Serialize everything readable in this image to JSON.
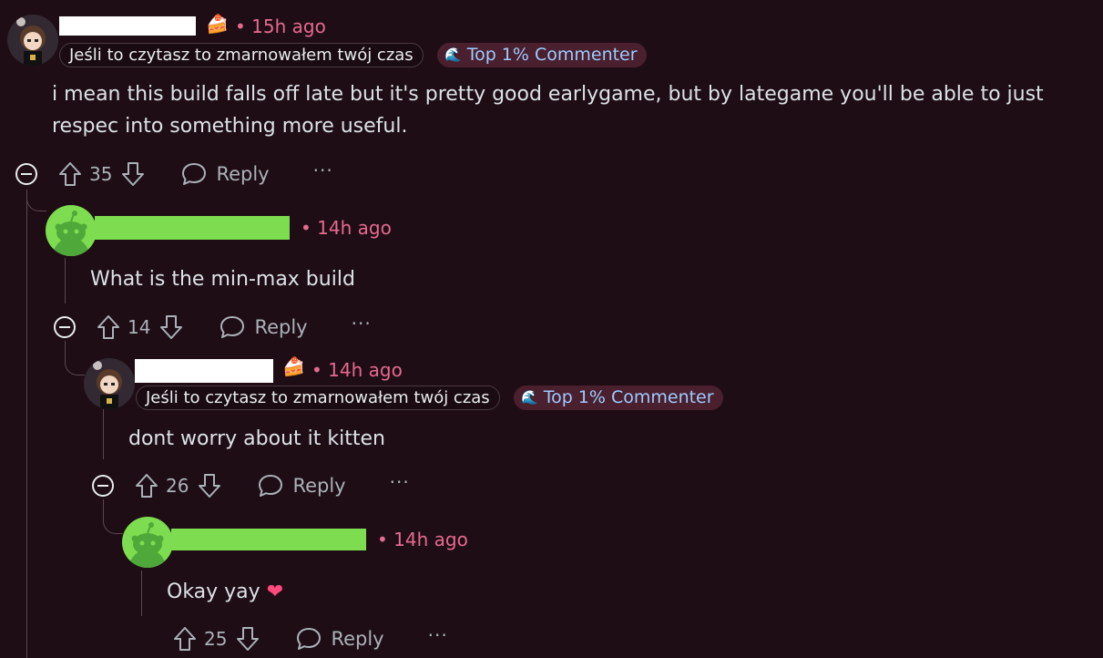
{
  "comments": [
    {
      "timestamp": "15h ago",
      "flair": "Jeśli to czytasz to zmarnowałem twój czas",
      "badge": "Top 1% Commenter",
      "text": "i mean this build falls off late but it's pretty good earlygame, but by lategame you'll be able to just respec into something more useful.",
      "score": "35",
      "reply_label": "Reply"
    },
    {
      "timestamp": "14h ago",
      "text": "What is the min-max build",
      "score": "14",
      "reply_label": "Reply"
    },
    {
      "timestamp": "14h ago",
      "flair": "Jeśli to czytasz to zmarnowałem twój czas",
      "badge": "Top 1% Commenter",
      "text": "dont worry about it kitten",
      "score": "26",
      "reply_label": "Reply"
    },
    {
      "timestamp": "14h ago",
      "text": "Okay yay",
      "score": "25",
      "reply_label": "Reply"
    }
  ],
  "icons": {
    "cake": "cake-day-icon",
    "badge": "fire-badge-icon",
    "heart": "heart-emoji",
    "collapse": "minus-circle-icon",
    "upvote": "arrow-up-icon",
    "downvote": "arrow-down-icon",
    "reply": "speech-bubble-icon",
    "more": "ellipsis-icon"
  },
  "colors": {
    "background": "#1f0d15",
    "timestamp": "#e56a8f",
    "redaction_green": "#7ddc4f",
    "badge_text": "#9ecbff"
  }
}
